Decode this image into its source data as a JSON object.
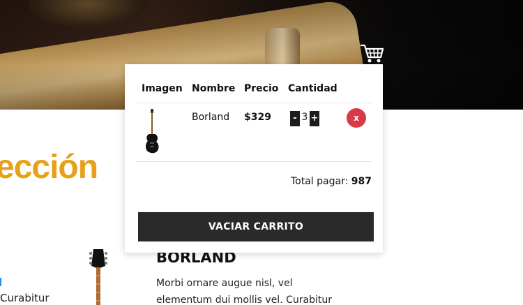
{
  "header": {
    "cart_icon": "shopping-cart-icon"
  },
  "page": {
    "section_heading": "ección",
    "edge_text": "Curabitur",
    "product": {
      "title": "BORLAND",
      "description_line1": "Morbi ornare augue nisl, vel",
      "description_line2": "elementum dui mollis vel. Curabitur"
    }
  },
  "cart": {
    "columns": [
      "Imagen",
      "Nombre",
      "Precio",
      "Cantidad"
    ],
    "items": [
      {
        "name": "Borland",
        "price": "$329",
        "quantity": "3",
        "decrement_label": "-",
        "increment_label": "+",
        "remove_label": "x"
      }
    ],
    "total_label": "Total pagar:",
    "total_value": "987",
    "empty_button_label": "VACIAR CARRITO"
  },
  "colors": {
    "accent": "#e7a017",
    "remove": "#d83a4a",
    "dark_button": "#2a2a2a"
  }
}
